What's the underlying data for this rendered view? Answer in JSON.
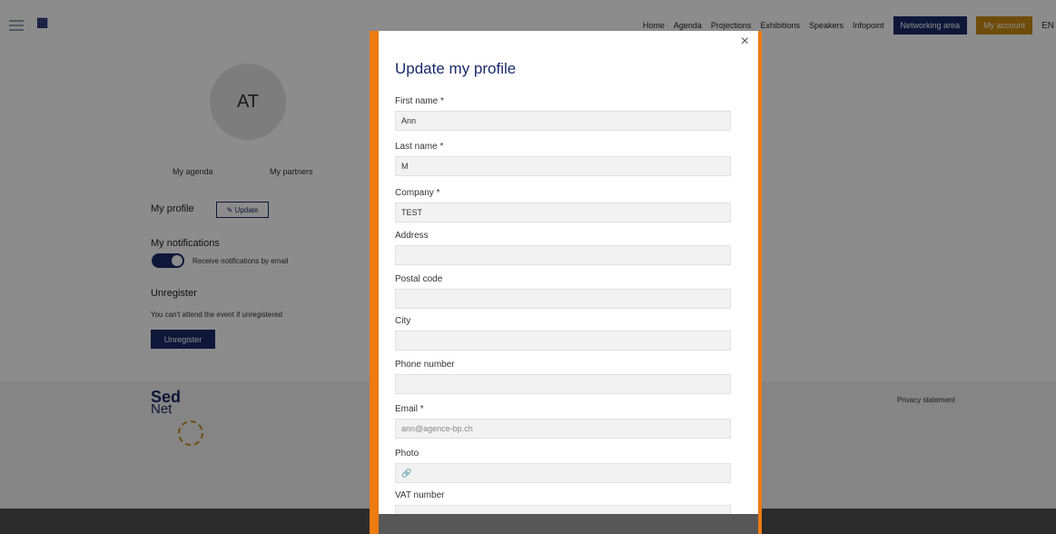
{
  "topbar": {
    "nav": [
      "Home",
      "Agenda",
      "Projections",
      "Exhibitions",
      "Speakers",
      "Infopoint"
    ],
    "networking_label": "Networking area",
    "account_label": "My account",
    "lang": "EN"
  },
  "profile": {
    "avatar_initials": "AT",
    "tabs": [
      "My agenda",
      "My partners"
    ],
    "my_profile_label": "My profile",
    "update_label": "✎ Update",
    "notifications_label": "My notifications",
    "notifications_text": "Receive notifications by email",
    "unregister_title": "Unregister",
    "unregister_text": "You can't attend the event if unregistered",
    "unregister_button": "Unregister"
  },
  "footer": {
    "brand_line1": "Sed",
    "brand_line2": "Net",
    "privacy": "Privacy statement"
  },
  "modal": {
    "close": "×",
    "title": "Update my profile",
    "fields": [
      {
        "label": "First name *",
        "value": "Ann"
      },
      {
        "label": "Last name *",
        "value": "M"
      },
      {
        "label": "Company *",
        "value": "TEST"
      },
      {
        "label": "Address",
        "value": ""
      },
      {
        "label": "Postal code",
        "value": ""
      },
      {
        "label": "City",
        "value": ""
      },
      {
        "label": "Phone number",
        "value": ""
      },
      {
        "label": "Email *",
        "value": "ann@agence-bp.ch"
      },
      {
        "label": "Photo",
        "value": "🔗"
      },
      {
        "label": "VAT number",
        "value": ""
      }
    ]
  },
  "colors": {
    "primary": "#1b2a6b",
    "accent": "#c98a12",
    "modal_border": "#ee7b12"
  }
}
